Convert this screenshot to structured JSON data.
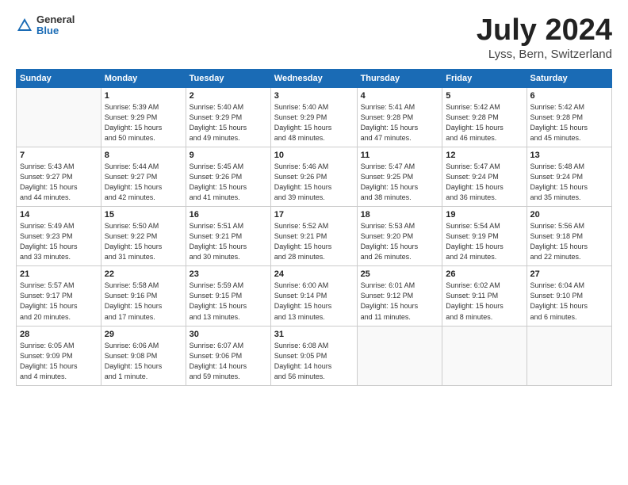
{
  "header": {
    "logo_general": "General",
    "logo_blue": "Blue",
    "month_title": "July 2024",
    "location": "Lyss, Bern, Switzerland"
  },
  "calendar": {
    "days_of_week": [
      "Sunday",
      "Monday",
      "Tuesday",
      "Wednesday",
      "Thursday",
      "Friday",
      "Saturday"
    ],
    "weeks": [
      [
        {
          "day": "",
          "info": ""
        },
        {
          "day": "1",
          "info": "Sunrise: 5:39 AM\nSunset: 9:29 PM\nDaylight: 15 hours\nand 50 minutes."
        },
        {
          "day": "2",
          "info": "Sunrise: 5:40 AM\nSunset: 9:29 PM\nDaylight: 15 hours\nand 49 minutes."
        },
        {
          "day": "3",
          "info": "Sunrise: 5:40 AM\nSunset: 9:29 PM\nDaylight: 15 hours\nand 48 minutes."
        },
        {
          "day": "4",
          "info": "Sunrise: 5:41 AM\nSunset: 9:28 PM\nDaylight: 15 hours\nand 47 minutes."
        },
        {
          "day": "5",
          "info": "Sunrise: 5:42 AM\nSunset: 9:28 PM\nDaylight: 15 hours\nand 46 minutes."
        },
        {
          "day": "6",
          "info": "Sunrise: 5:42 AM\nSunset: 9:28 PM\nDaylight: 15 hours\nand 45 minutes."
        }
      ],
      [
        {
          "day": "7",
          "info": "Sunrise: 5:43 AM\nSunset: 9:27 PM\nDaylight: 15 hours\nand 44 minutes."
        },
        {
          "day": "8",
          "info": "Sunrise: 5:44 AM\nSunset: 9:27 PM\nDaylight: 15 hours\nand 42 minutes."
        },
        {
          "day": "9",
          "info": "Sunrise: 5:45 AM\nSunset: 9:26 PM\nDaylight: 15 hours\nand 41 minutes."
        },
        {
          "day": "10",
          "info": "Sunrise: 5:46 AM\nSunset: 9:26 PM\nDaylight: 15 hours\nand 39 minutes."
        },
        {
          "day": "11",
          "info": "Sunrise: 5:47 AM\nSunset: 9:25 PM\nDaylight: 15 hours\nand 38 minutes."
        },
        {
          "day": "12",
          "info": "Sunrise: 5:47 AM\nSunset: 9:24 PM\nDaylight: 15 hours\nand 36 minutes."
        },
        {
          "day": "13",
          "info": "Sunrise: 5:48 AM\nSunset: 9:24 PM\nDaylight: 15 hours\nand 35 minutes."
        }
      ],
      [
        {
          "day": "14",
          "info": "Sunrise: 5:49 AM\nSunset: 9:23 PM\nDaylight: 15 hours\nand 33 minutes."
        },
        {
          "day": "15",
          "info": "Sunrise: 5:50 AM\nSunset: 9:22 PM\nDaylight: 15 hours\nand 31 minutes."
        },
        {
          "day": "16",
          "info": "Sunrise: 5:51 AM\nSunset: 9:21 PM\nDaylight: 15 hours\nand 30 minutes."
        },
        {
          "day": "17",
          "info": "Sunrise: 5:52 AM\nSunset: 9:21 PM\nDaylight: 15 hours\nand 28 minutes."
        },
        {
          "day": "18",
          "info": "Sunrise: 5:53 AM\nSunset: 9:20 PM\nDaylight: 15 hours\nand 26 minutes."
        },
        {
          "day": "19",
          "info": "Sunrise: 5:54 AM\nSunset: 9:19 PM\nDaylight: 15 hours\nand 24 minutes."
        },
        {
          "day": "20",
          "info": "Sunrise: 5:56 AM\nSunset: 9:18 PM\nDaylight: 15 hours\nand 22 minutes."
        }
      ],
      [
        {
          "day": "21",
          "info": "Sunrise: 5:57 AM\nSunset: 9:17 PM\nDaylight: 15 hours\nand 20 minutes."
        },
        {
          "day": "22",
          "info": "Sunrise: 5:58 AM\nSunset: 9:16 PM\nDaylight: 15 hours\nand 17 minutes."
        },
        {
          "day": "23",
          "info": "Sunrise: 5:59 AM\nSunset: 9:15 PM\nDaylight: 15 hours\nand 13 minutes."
        },
        {
          "day": "24",
          "info": "Sunrise: 6:00 AM\nSunset: 9:14 PM\nDaylight: 15 hours\nand 13 minutes."
        },
        {
          "day": "25",
          "info": "Sunrise: 6:01 AM\nSunset: 9:12 PM\nDaylight: 15 hours\nand 11 minutes."
        },
        {
          "day": "26",
          "info": "Sunrise: 6:02 AM\nSunset: 9:11 PM\nDaylight: 15 hours\nand 8 minutes."
        },
        {
          "day": "27",
          "info": "Sunrise: 6:04 AM\nSunset: 9:10 PM\nDaylight: 15 hours\nand 6 minutes."
        }
      ],
      [
        {
          "day": "28",
          "info": "Sunrise: 6:05 AM\nSunset: 9:09 PM\nDaylight: 15 hours\nand 4 minutes."
        },
        {
          "day": "29",
          "info": "Sunrise: 6:06 AM\nSunset: 9:08 PM\nDaylight: 15 hours\nand 1 minute."
        },
        {
          "day": "30",
          "info": "Sunrise: 6:07 AM\nSunset: 9:06 PM\nDaylight: 14 hours\nand 59 minutes."
        },
        {
          "day": "31",
          "info": "Sunrise: 6:08 AM\nSunset: 9:05 PM\nDaylight: 14 hours\nand 56 minutes."
        },
        {
          "day": "",
          "info": ""
        },
        {
          "day": "",
          "info": ""
        },
        {
          "day": "",
          "info": ""
        }
      ]
    ]
  }
}
